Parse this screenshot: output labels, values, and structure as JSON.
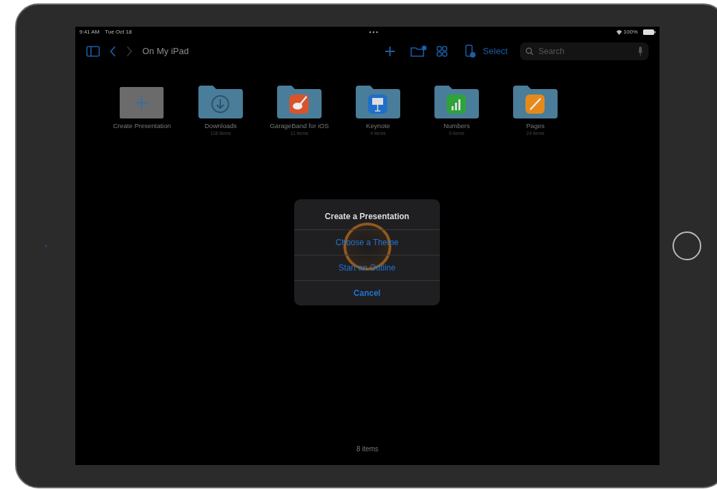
{
  "status_bar": {
    "time": "9:41 AM",
    "date": "Tue Oct 18",
    "battery": "100%"
  },
  "toolbar": {
    "title": "On My iPad",
    "select": "Select",
    "search": {
      "placeholder": "Search"
    }
  },
  "items": [
    {
      "kind": "create",
      "name": "Create Presentation"
    },
    {
      "kind": "downloads",
      "name": "Downloads",
      "count": "118 items"
    },
    {
      "kind": "garageband",
      "name": "GarageBand for iOS",
      "count": "11 items"
    },
    {
      "kind": "keynote",
      "name": "Keynote",
      "count": "4 items"
    },
    {
      "kind": "numbers",
      "name": "Numbers",
      "count": "0 items"
    },
    {
      "kind": "pages",
      "name": "Pages",
      "count": "24 items"
    }
  ],
  "dialog": {
    "title": "Create a Presentation",
    "actions": [
      {
        "label": "Choose a Theme",
        "kind": "action",
        "tapped": true
      },
      {
        "label": "Start an Outline",
        "kind": "action",
        "tapped": false
      },
      {
        "label": "Cancel",
        "kind": "cancel",
        "tapped": false
      }
    ]
  },
  "footer": "8 items"
}
